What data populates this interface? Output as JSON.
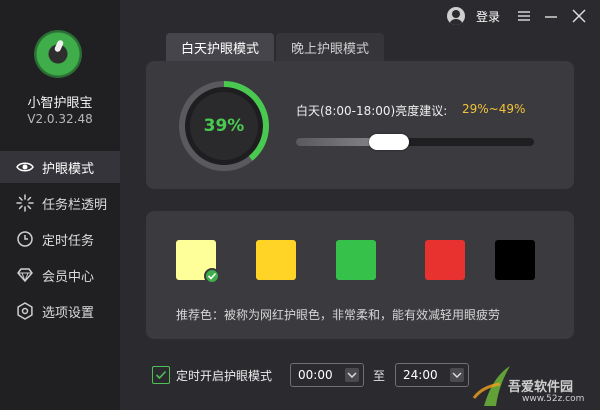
{
  "app": {
    "name": "小智护眼宝",
    "version": "V2.0.32.48"
  },
  "titlebar": {
    "login_label": "登录"
  },
  "sidebar": {
    "items": [
      {
        "label": "护眼模式",
        "icon": "eye-icon",
        "active": true
      },
      {
        "label": "任务栏透明",
        "icon": "sparkle-icon",
        "active": false
      },
      {
        "label": "定时任务",
        "icon": "clock-icon",
        "active": false
      },
      {
        "label": "会员中心",
        "icon": "diamond-icon",
        "active": false
      },
      {
        "label": "选项设置",
        "icon": "settings-icon",
        "active": false
      }
    ]
  },
  "tabs": [
    {
      "label": "白天护眼模式",
      "active": true
    },
    {
      "label": "晚上护眼模式",
      "active": false
    }
  ],
  "brightness": {
    "percent": 39,
    "percent_text": "39%",
    "suggestion_label": "白天(8:00-18:00)亮度建议:",
    "suggestion_range": "29%~49%",
    "slider_fraction": 0.39
  },
  "colors": {
    "swatches": [
      {
        "name": "light-yellow",
        "hex": "#ffff99",
        "selected": true
      },
      {
        "name": "yellow",
        "hex": "#ffd426",
        "selected": false
      },
      {
        "name": "green",
        "hex": "#36c24a",
        "selected": false
      },
      {
        "name": "red",
        "hex": "#e8322f",
        "selected": false
      },
      {
        "name": "black",
        "hex": "#000000",
        "selected": false
      }
    ],
    "recommendation": "推荐色：被称为网红护眼色，非常柔和，能有效减轻用眼疲劳"
  },
  "schedule": {
    "enabled": true,
    "label": "定时开启护眼模式",
    "start": "00:00",
    "to_label": "至",
    "end": "24:00"
  },
  "accent": {
    "green": "#49c94f",
    "orange": "#f2c33a"
  },
  "watermark": {
    "text": "吾爱软件园",
    "url": "www.52z.com"
  }
}
